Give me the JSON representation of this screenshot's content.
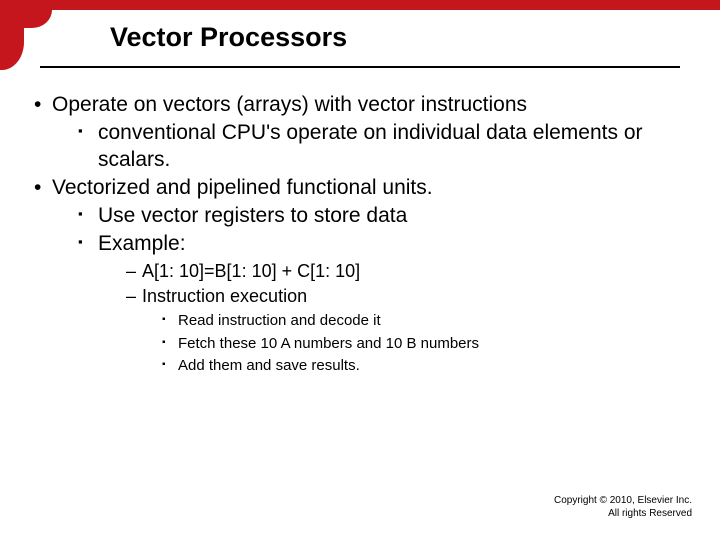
{
  "title": "Vector Processors",
  "bullets": {
    "b1": "Operate on vectors (arrays) with vector instructions",
    "b1_1": "conventional CPU's operate on individual data elements or scalars.",
    "b2": "Vectorized and pipelined functional units.",
    "b2_1": "Use  vector registers to store data",
    "b2_2": "Example:",
    "b2_2_1": "A[1: 10]=B[1: 10] + C[1: 10]",
    "b2_2_2": "Instruction execution",
    "b2_2_2_1": "Read instruction and decode it",
    "b2_2_2_2": "Fetch these 10 A numbers and 10 B numbers",
    "b2_2_2_3": "Add them and save results."
  },
  "copyright": {
    "line1": "Copyright © 2010, Elsevier Inc.",
    "line2": "All rights Reserved"
  }
}
